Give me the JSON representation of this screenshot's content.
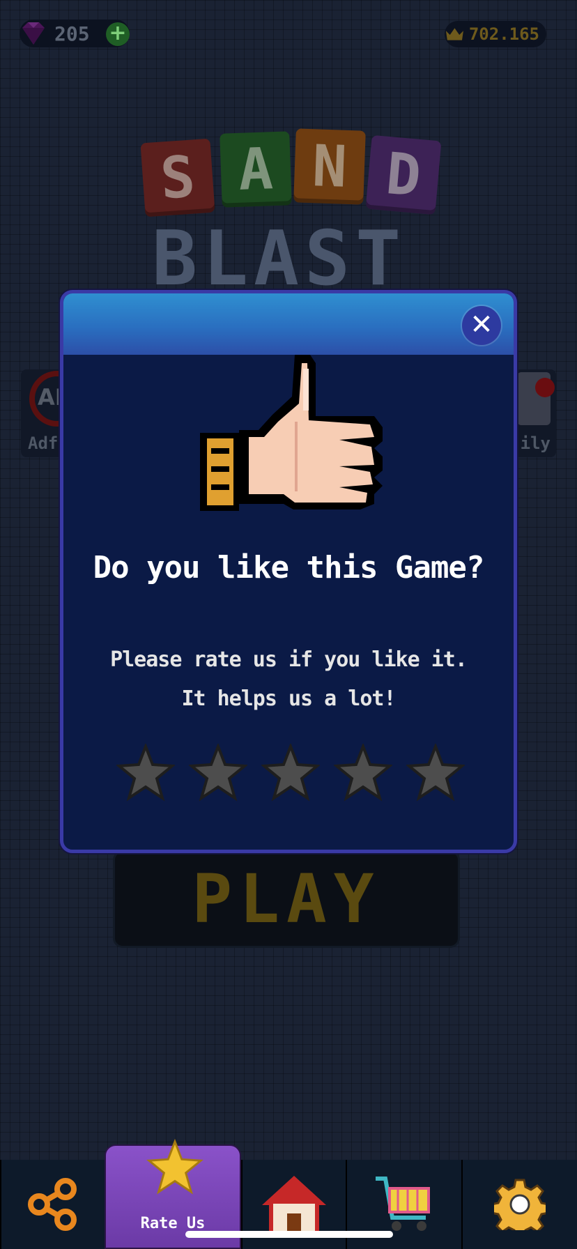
{
  "topbar": {
    "gems": "205",
    "gem_plus": "+",
    "crowns": "702.165"
  },
  "logo": {
    "tiles": [
      "S",
      "A",
      "N",
      "D"
    ],
    "word": "BLAST"
  },
  "side_menu": {
    "left_badge": "AD",
    "left_label": "Adf",
    "right_label": "ily"
  },
  "play_label": "PLAY",
  "rate_dialog": {
    "close_label": "✕",
    "title": "Do you like this Game?",
    "message_line1": "Please rate us if you like it.",
    "message_line2": "It helps us a lot!",
    "stars_total": 5,
    "stars_selected": 0
  },
  "bottom_nav": {
    "rate_label": "Rate Us"
  },
  "colors": {
    "modal_bg": "#0b1a46",
    "modal_border": "#3a3aa6",
    "header_top": "#2f8fd0",
    "star_fill": "#4d4d4d",
    "rate_tab": "#7a46bb"
  }
}
